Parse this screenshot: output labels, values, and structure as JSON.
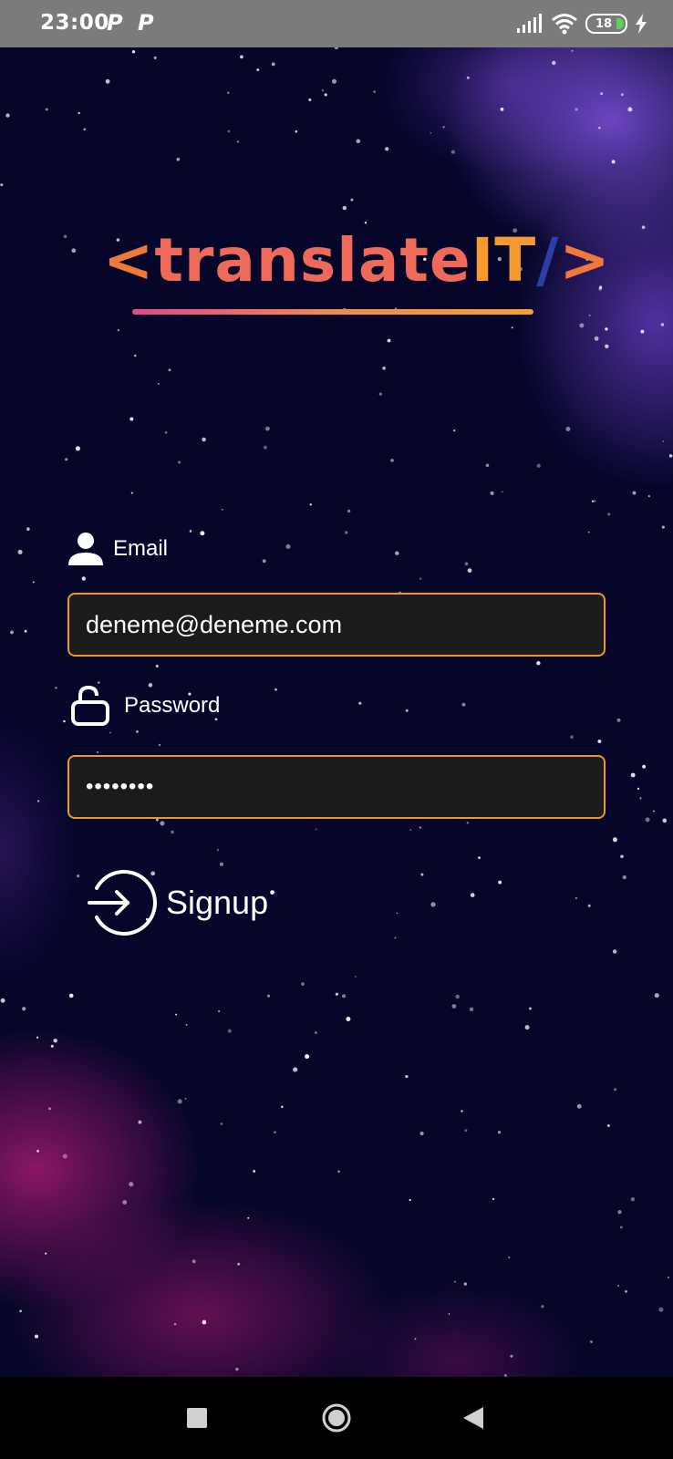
{
  "status_bar": {
    "time": "23:00",
    "notification_icons": [
      "P",
      "P"
    ],
    "battery_level": "18",
    "icons": [
      "signal-icon",
      "wifi-icon",
      "battery-icon",
      "charging-icon"
    ]
  },
  "logo": {
    "open_bracket": "<",
    "word": "translate",
    "it": "IT",
    "slash": "/",
    "close_bracket": ">"
  },
  "form": {
    "email_label": "Email",
    "email_value": "deneme@deneme.com",
    "password_label": "Password",
    "password_value": "••••••••",
    "signup_label": "Signup"
  },
  "nav_bar": {
    "buttons": [
      "recents-square-icon",
      "home-circle-icon",
      "back-triangle-icon"
    ]
  },
  "colors": {
    "accent_border": "#e89a2a",
    "input_background": "#1b1b1b",
    "background": "#06062a",
    "logo_orange": "#f5a030",
    "logo_pink": "#f06a5a"
  }
}
